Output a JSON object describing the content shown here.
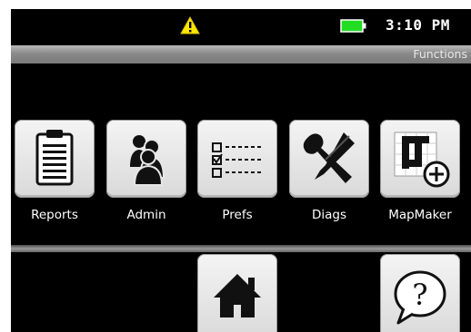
{
  "status": {
    "clock": "3:10 PM",
    "icons": [
      "warning-icon",
      "battery-icon"
    ],
    "battery_color": "#22dd22",
    "warning_color": "#ffe600"
  },
  "header": {
    "title": "Functions"
  },
  "apps": [
    {
      "label": "Reports",
      "icon": "clipboard-icon"
    },
    {
      "label": "Admin",
      "icon": "users-icon"
    },
    {
      "label": "Prefs",
      "icon": "checklist-icon"
    },
    {
      "label": "Diags",
      "icon": "tools-icon"
    },
    {
      "label": "MapMaker",
      "icon": "map-add-icon"
    }
  ],
  "bottom": {
    "icons": [
      "home-icon",
      "help-icon"
    ]
  }
}
